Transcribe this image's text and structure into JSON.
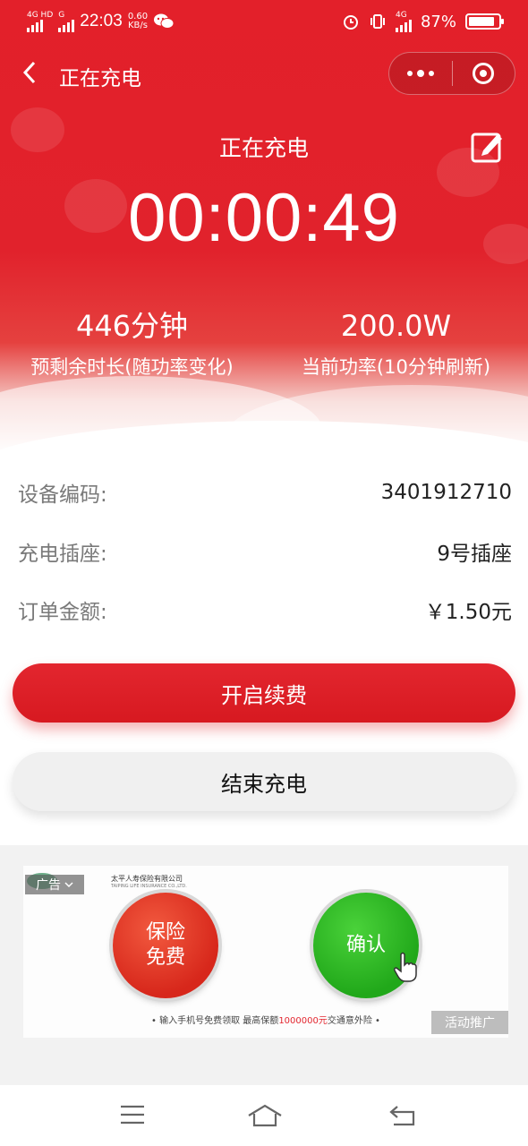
{
  "status_bar": {
    "net1": "4G HD",
    "net2": "G",
    "time": "22:03",
    "speed_value": "0.60",
    "speed_unit": "KB/s",
    "net3": "4G",
    "battery": "87%",
    "battery_level": 0.87
  },
  "nav": {
    "title": "正在充电"
  },
  "charging": {
    "status": "正在充电",
    "timer": "00:00:49",
    "remaining_value": "446分钟",
    "remaining_label": "预剩余时长(随功率变化)",
    "power_value": "200.0W",
    "power_label": "当前功率(10分钟刷新)"
  },
  "details": [
    {
      "key": "设备编码:",
      "value": "3401912710"
    },
    {
      "key": "充电插座:",
      "value": "9号插座"
    },
    {
      "key": "订单金额:",
      "value": "￥1.50元"
    }
  ],
  "buttons": {
    "renew": "开启续费",
    "end": "结束充电"
  },
  "ad": {
    "company": "太平人寿保险有限公司",
    "company_en": "TAIPING LIFE INSURANCE CO.,LTD.",
    "tag": "广告",
    "left_btn_line1": "保险",
    "left_btn_line2": "免费",
    "right_btn": "确认",
    "note_prefix": "• 输入手机号免费领取 最高保额",
    "note_highlight": "1000000元",
    "note_suffix": "交通意外险 •",
    "promo": "活动推广"
  },
  "colors": {
    "brand_red": "#e3202a",
    "green": "#21a81a"
  }
}
